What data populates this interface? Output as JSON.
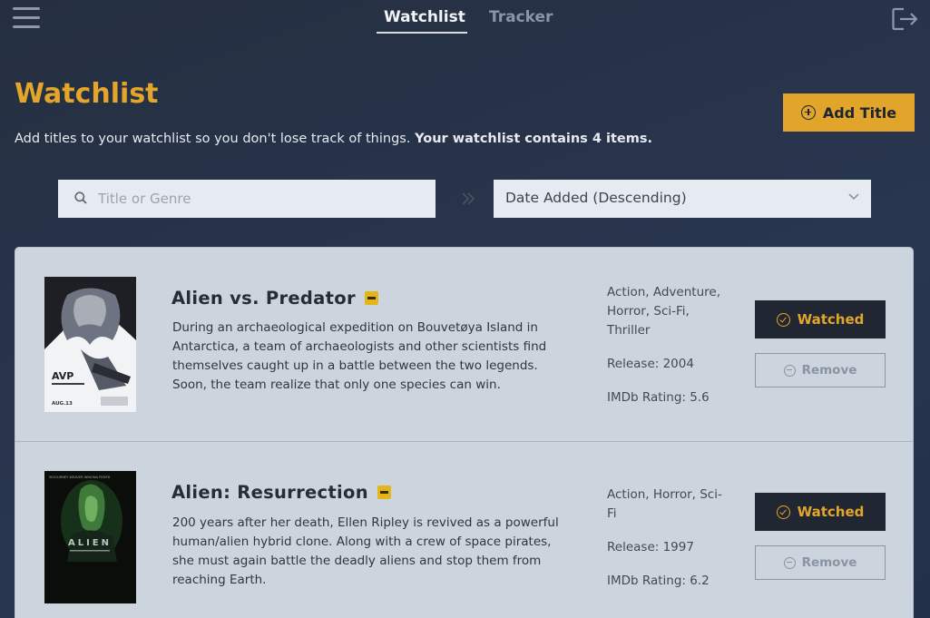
{
  "nav": {
    "tabs": [
      {
        "label": "Watchlist",
        "active": true
      },
      {
        "label": "Tracker",
        "active": false
      }
    ],
    "menu_icon": "hamburger-menu-icon",
    "logout_icon": "logout-icon"
  },
  "header": {
    "title": "Watchlist",
    "subtitle_plain": "Add titles to your watchlist so you don't lose track of things. ",
    "subtitle_bold": "Your watchlist contains 4 items.",
    "add_button_label": "Add Title"
  },
  "search": {
    "placeholder": "Title or Genre",
    "value": ""
  },
  "sort": {
    "selected": "Date Added (Descending)"
  },
  "items": [
    {
      "title": "Alien vs. Predator",
      "description": "During an archaeological expedition on Bouvetøya Island in Antarctica, a team of archaeologists and other scientists find themselves caught up in a battle between the two legends. Soon, the team realize that only one species can win.",
      "genres": "Action, Adventure, Horror, Sci-Fi, Thriller",
      "release": "Release: 2004",
      "rating": "IMDb Rating: 5.6",
      "watched_label": "Watched",
      "remove_label": "Remove",
      "poster_text": "AVP",
      "poster_date": "AUG.13"
    },
    {
      "title": "Alien: Resurrection",
      "description": "200 years after her death, Ellen Ripley is revived as a powerful human/alien hybrid clone. Along with a crew of space pirates, she must again battle the deadly aliens and stop them from reaching Earth.",
      "genres": "Action, Horror, Sci-Fi",
      "release": "Release: 1997",
      "rating": "IMDb Rating: 6.2",
      "watched_label": "Watched",
      "remove_label": "Remove",
      "poster_text": "ALIEN",
      "poster_names": "SIGOURNEY WEAVER   WINONA RYDER"
    }
  ],
  "colors": {
    "accent": "#e3a62b",
    "background": "#252f40",
    "card": "#ccd4de",
    "dark_button": "#202632"
  }
}
